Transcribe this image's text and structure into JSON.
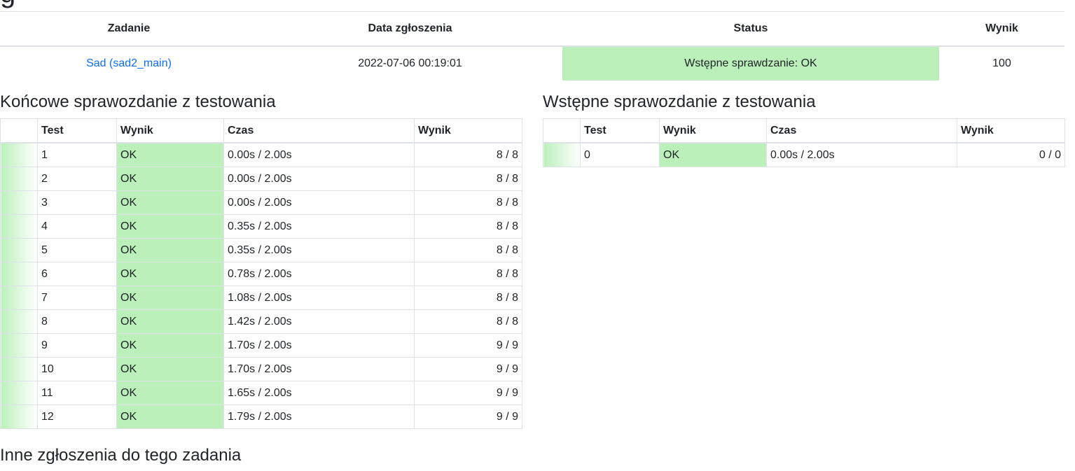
{
  "page": {
    "heading_fragment": "g"
  },
  "summary": {
    "headers": {
      "task": "Zadanie",
      "date": "Data zgłoszenia",
      "status": "Status",
      "score": "Wynik"
    },
    "row": {
      "task": "Sad (sad2_main)",
      "date": "2022-07-06 00:19:01",
      "status": "Wstępne sprawdzanie: OK",
      "score": "100"
    }
  },
  "final_report": {
    "title": "Końcowe sprawozdanie z testowania",
    "headers": {
      "blank": "",
      "test": "Test",
      "result": "Wynik",
      "time": "Czas",
      "points": "Wynik"
    },
    "rows": [
      {
        "test": "1",
        "result": "OK",
        "time": "0.00s / 2.00s",
        "points": "8 / 8"
      },
      {
        "test": "2",
        "result": "OK",
        "time": "0.00s / 2.00s",
        "points": "8 / 8"
      },
      {
        "test": "3",
        "result": "OK",
        "time": "0.00s / 2.00s",
        "points": "8 / 8"
      },
      {
        "test": "4",
        "result": "OK",
        "time": "0.35s / 2.00s",
        "points": "8 / 8"
      },
      {
        "test": "5",
        "result": "OK",
        "time": "0.35s / 2.00s",
        "points": "8 / 8"
      },
      {
        "test": "6",
        "result": "OK",
        "time": "0.78s / 2.00s",
        "points": "8 / 8"
      },
      {
        "test": "7",
        "result": "OK",
        "time": "1.08s / 2.00s",
        "points": "8 / 8"
      },
      {
        "test": "8",
        "result": "OK",
        "time": "1.42s / 2.00s",
        "points": "8 / 8"
      },
      {
        "test": "9",
        "result": "OK",
        "time": "1.70s / 2.00s",
        "points": "9 / 9"
      },
      {
        "test": "10",
        "result": "OK",
        "time": "1.70s / 2.00s",
        "points": "9 / 9"
      },
      {
        "test": "11",
        "result": "OK",
        "time": "1.65s / 2.00s",
        "points": "9 / 9"
      },
      {
        "test": "12",
        "result": "OK",
        "time": "1.79s / 2.00s",
        "points": "9 / 9"
      }
    ]
  },
  "initial_report": {
    "title": "Wstępne sprawozdanie z testowania",
    "headers": {
      "blank": "",
      "test": "Test",
      "result": "Wynik",
      "time": "Czas",
      "points": "Wynik"
    },
    "rows": [
      {
        "test": "0",
        "result": "OK",
        "time": "0.00s / 2.00s",
        "points": "0 / 0"
      }
    ]
  },
  "other_submissions": {
    "title": "Inne zgłoszenia do tego zadania"
  },
  "colors": {
    "ok_green": "#bbf0bb",
    "link_blue": "#0d6efd",
    "border": "#dee2e6"
  }
}
